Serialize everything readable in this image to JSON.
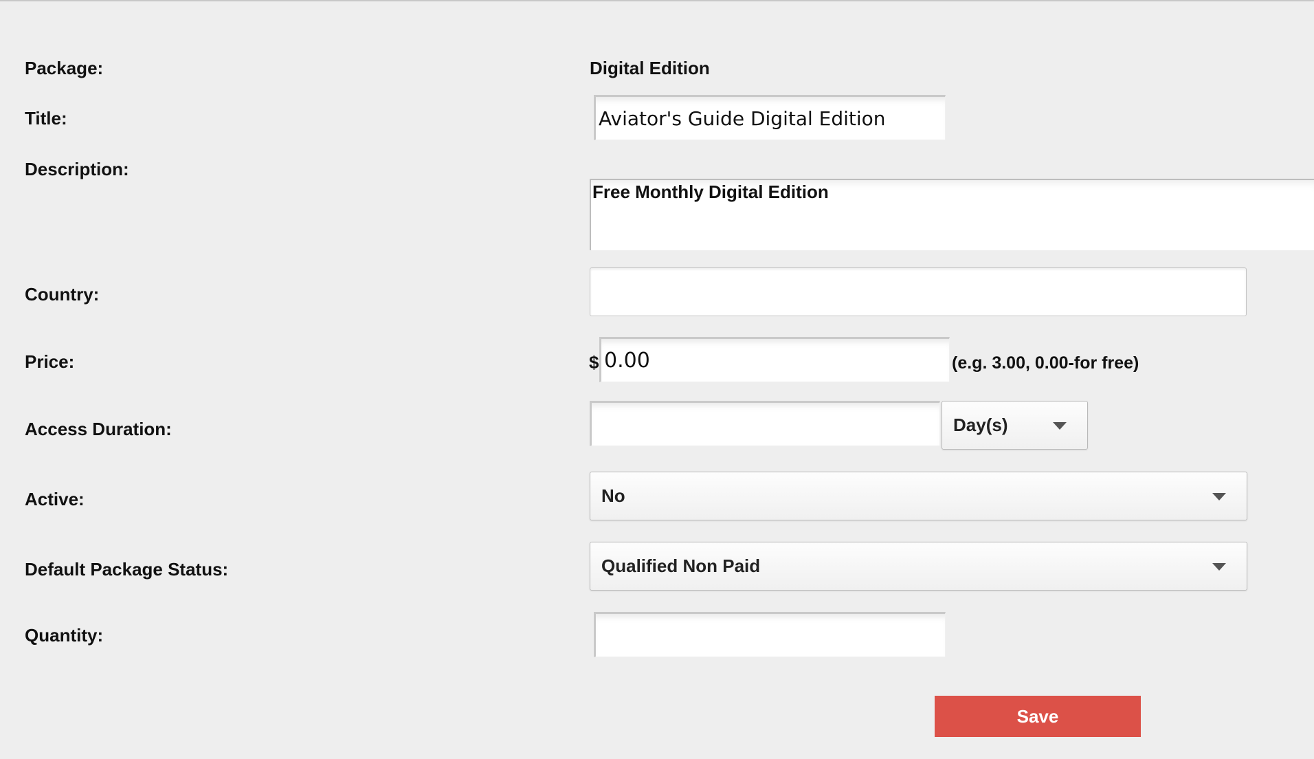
{
  "form": {
    "package": {
      "label": "Package:",
      "value": "Digital Edition"
    },
    "title": {
      "label": "Title:",
      "value": "Aviator's Guide Digital Edition"
    },
    "description": {
      "label": "Description:",
      "value": "Free Monthly Digital Edition"
    },
    "country": {
      "label": "Country:",
      "value": ""
    },
    "price": {
      "label": "Price:",
      "currency_symbol": "$",
      "value": "0.00",
      "hint": "(e.g. 3.00, 0.00-for free)"
    },
    "access_duration": {
      "label": "Access Duration:",
      "value": "",
      "unit_selected": "Day(s)"
    },
    "active": {
      "label": "Active:",
      "selected": "No"
    },
    "default_package_status": {
      "label": "Default Package Status:",
      "selected": "Qualified Non Paid"
    },
    "quantity": {
      "label": "Quantity:",
      "value": ""
    }
  },
  "actions": {
    "save_label": "Save"
  },
  "colors": {
    "background": "#eeeeee",
    "save_button": "#dc5148",
    "save_text": "#ffffff"
  },
  "icons": {
    "dropdown": "chevron-down-icon"
  }
}
